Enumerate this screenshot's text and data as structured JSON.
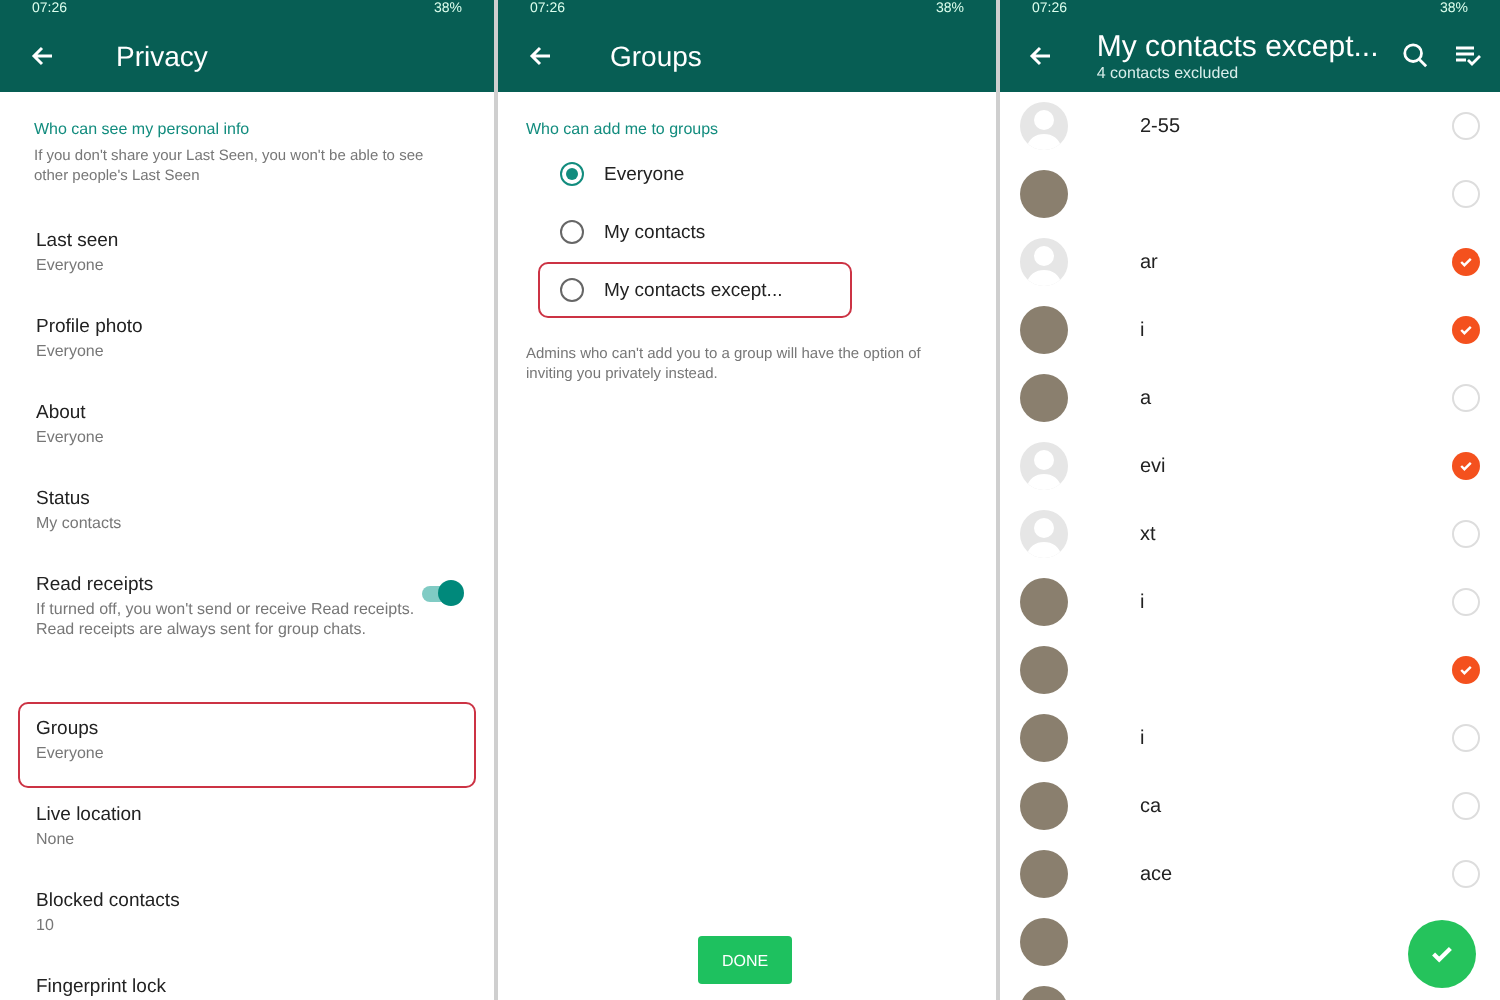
{
  "privacy": {
    "status_bar": {
      "time": "07:26",
      "battery": "38%"
    },
    "title": "Privacy",
    "section_title": "Who can see my personal info",
    "section_note": "If you don't share your Last Seen, you won't be able to see other people's Last Seen",
    "items": [
      {
        "kind": "setting",
        "label": "Last seen",
        "value": "Everyone",
        "highlighted": false
      },
      {
        "kind": "setting",
        "label": "Profile photo",
        "value": "Everyone",
        "highlighted": false
      },
      {
        "kind": "setting",
        "label": "About",
        "value": "Everyone",
        "highlighted": false
      },
      {
        "kind": "setting",
        "label": "Status",
        "value": "My contacts",
        "highlighted": false
      },
      {
        "kind": "toggle",
        "label": "Read receipts",
        "value": "If turned off, you won't send or receive Read receipts. Read receipts are always sent for group chats.",
        "on": true,
        "highlighted": false
      },
      {
        "kind": "setting",
        "label": "Groups",
        "value": "Everyone",
        "highlighted": true
      },
      {
        "kind": "setting",
        "label": "Live location",
        "value": "None",
        "highlighted": false
      },
      {
        "kind": "setting",
        "label": "Blocked contacts",
        "value": "10",
        "highlighted": false
      },
      {
        "kind": "setting",
        "label": "Fingerprint lock",
        "highlighted": false
      }
    ]
  },
  "groups": {
    "status_bar": {
      "time": "07:26",
      "battery": "38%"
    },
    "title": "Groups",
    "section_title": "Who can add me to groups",
    "options": [
      {
        "label": "Everyone",
        "selected": true,
        "highlighted": false
      },
      {
        "label": "My contacts",
        "selected": false,
        "highlighted": false
      },
      {
        "label": "My contacts except...",
        "selected": false,
        "highlighted": true
      }
    ],
    "note": "Admins who can't add you to a group will have the option of inviting you privately instead.",
    "done_button": "DONE"
  },
  "contacts": {
    "status_bar": {
      "time": "07:26",
      "battery": "38%"
    },
    "title": "My contacts except...",
    "subtitle": "4 contacts excluded",
    "rows": [
      {
        "kind": "default",
        "name": "2-55",
        "checked": false
      },
      {
        "kind": "photo",
        "checked": false
      },
      {
        "kind": "default",
        "name": "ar",
        "checked": true
      },
      {
        "kind": "photo",
        "name": "i",
        "checked": true
      },
      {
        "kind": "photo",
        "name": "a",
        "checked": false
      },
      {
        "kind": "default",
        "name": "evi",
        "checked": true
      },
      {
        "kind": "default",
        "name": "xt",
        "checked": false
      },
      {
        "kind": "photo",
        "name": "i",
        "checked": false
      },
      {
        "kind": "photo",
        "checked": true
      },
      {
        "kind": "photo",
        "name": "i",
        "checked": false
      },
      {
        "kind": "photo",
        "name": "ca",
        "checked": false
      },
      {
        "kind": "photo",
        "name": "ace",
        "checked": false
      },
      {
        "kind": "photo"
      },
      {
        "kind": "photo"
      }
    ]
  }
}
